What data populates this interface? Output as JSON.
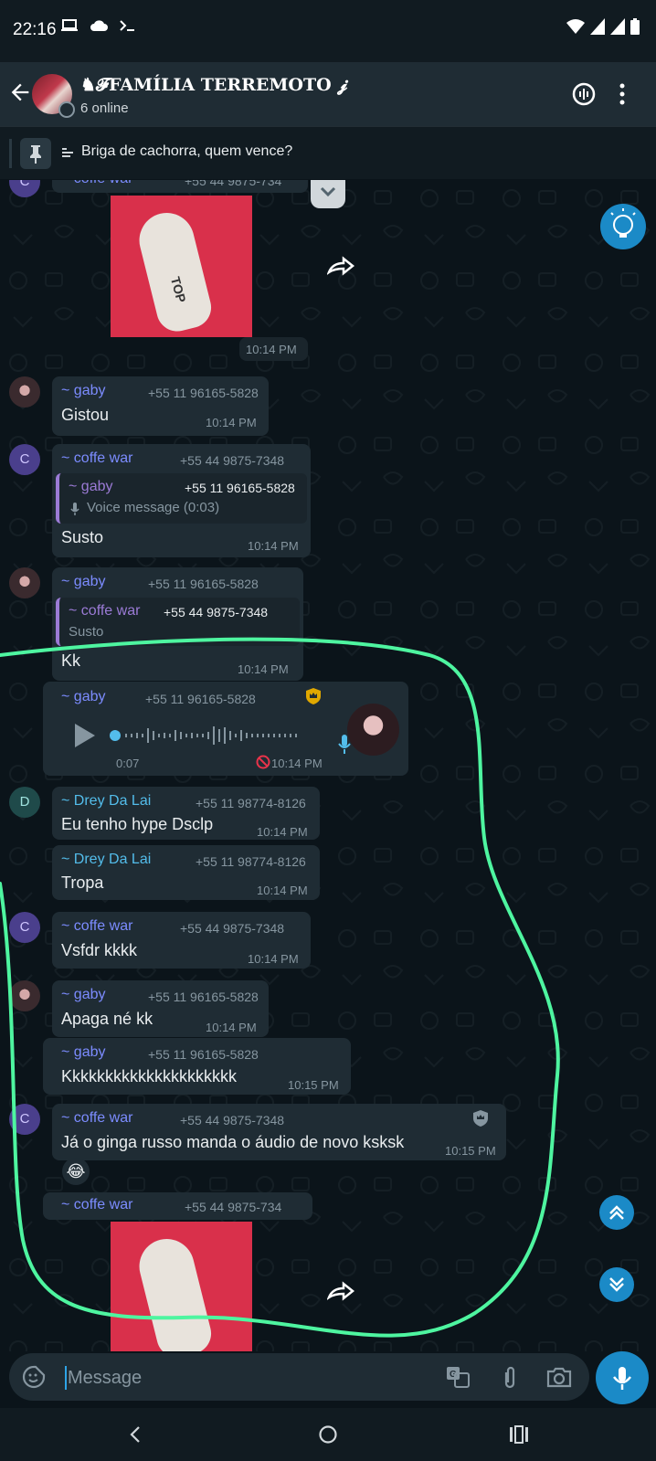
{
  "status_bar": {
    "time": "22:16",
    "left_icons": [
      "laptop-icon",
      "cloud-icon",
      "terminal-icon"
    ],
    "right_icons": [
      "wifi-icon",
      "signal-icon",
      "signal-icon",
      "battery-icon"
    ]
  },
  "header": {
    "title": "♞𝓕FAMÍLIA TERREMOTO 𝓳",
    "subtitle": "6 online"
  },
  "pinned": {
    "text": "Briga de cachorra, quem vence?"
  },
  "messages": {
    "m1": {
      "sender": "~ coffe war",
      "phone": "+55 44 9875-734",
      "time": "10:14 PM"
    },
    "m2": {
      "sender": "~ gaby",
      "phone": "+55 11 96165-5828",
      "text": "Gistou",
      "time": "10:14 PM"
    },
    "m3": {
      "sender": "~ coffe war",
      "phone": "+55 44 9875-7348",
      "quote_sender": "~ gaby",
      "quote_phone": "+55 11 96165-5828",
      "quote_text": "Voice message (0:03)",
      "text": "Susto",
      "time": "10:14 PM"
    },
    "m4": {
      "sender": "~ gaby",
      "phone": "+55 11 96165-5828",
      "quote_sender": "~ coffe war",
      "quote_phone": "+55 44 9875-7348",
      "quote_text": "Susto",
      "text": "Kk",
      "time": "10:14 PM"
    },
    "m5": {
      "sender": "~ gaby",
      "phone": "+55 11 96165-5828",
      "duration": "0:07",
      "time": "10:14 PM"
    },
    "m6": {
      "sender": "~ Drey Da Lai",
      "phone": "+55 11 98774-8126",
      "text": "Eu tenho hype Dsclp",
      "time": "10:14 PM"
    },
    "m7": {
      "sender": "~ Drey Da Lai",
      "phone": "+55 11 98774-8126",
      "text": "Tropa",
      "time": "10:14 PM"
    },
    "m8": {
      "sender": "~ coffe war",
      "phone": "+55 44 9875-7348",
      "text": "Vsfdr kkkk",
      "time": "10:14 PM"
    },
    "m9": {
      "sender": "~ gaby",
      "phone": "+55 11 96165-5828",
      "text": "Apaga né kk",
      "time": "10:14 PM"
    },
    "m10": {
      "sender": "~ gaby",
      "phone": "+55 11 96165-5828",
      "text": "Kkkkkkkkkkkkkkkkkkkkk",
      "time": "10:15 PM"
    },
    "m11": {
      "sender": "~ coffe war",
      "phone": "+55 44 9875-7348",
      "text": "Já o ginga russo manda o áudio de novo ksksk",
      "time": "10:15 PM",
      "reaction": "😂"
    },
    "m12": {
      "sender": "~ coffe war",
      "phone": "+55 44 9875-734",
      "photo_text": "TOP"
    }
  },
  "avatars": {
    "c": "C",
    "d": "D"
  },
  "input": {
    "placeholder": "Message"
  },
  "colors": {
    "coffe_war": "#7c8cff",
    "gaby": "#7c8cff",
    "drey": "#53bdeb",
    "accent_blue": "#1b8ac7",
    "highlight": "#4ef5a0"
  }
}
